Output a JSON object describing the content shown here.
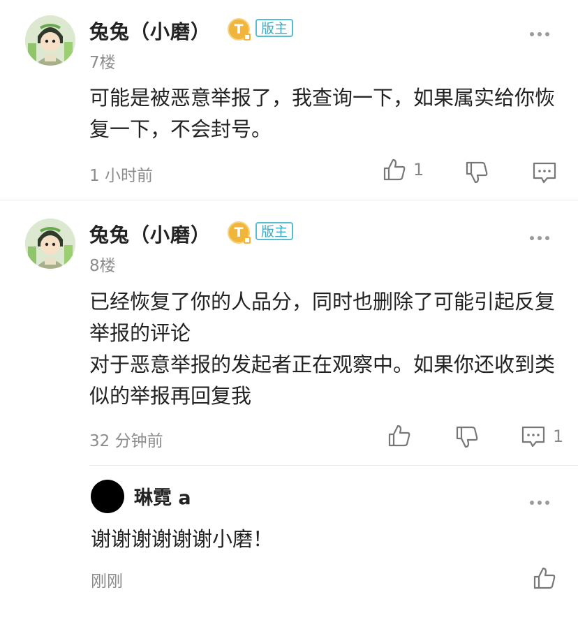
{
  "comments": [
    {
      "username": "兔兔（小磨）",
      "level_badge": "T",
      "role_badge": "版主",
      "floor": "7楼",
      "content": [
        "可能是被恶意举报了，我查询一下，如果属实给你恢复一下，不会封号。"
      ],
      "time": "1 小时前",
      "like_count": "1",
      "reply_count": ""
    },
    {
      "username": "兔兔（小磨）",
      "level_badge": "T",
      "role_badge": "版主",
      "floor": "8楼",
      "content": [
        "已经恢复了你的人品分，同时也删除了可能引起反复举报的评论",
        "对于恶意举报的发起者正在观察中。如果你还收到类似的举报再回复我"
      ],
      "time": "32 分钟前",
      "like_count": "",
      "reply_count": "1"
    }
  ],
  "reply": {
    "username": "琳霓 a",
    "content": "谢谢谢谢谢谢小磨！",
    "time": "刚刚"
  },
  "colors": {
    "accent_badge": "#f0b53b",
    "role_badge": "#55bdd0",
    "muted_text": "#8c8c8c"
  },
  "icons": [
    "more-icon",
    "thumbs-up-icon",
    "thumbs-down-icon",
    "comment-icon"
  ]
}
